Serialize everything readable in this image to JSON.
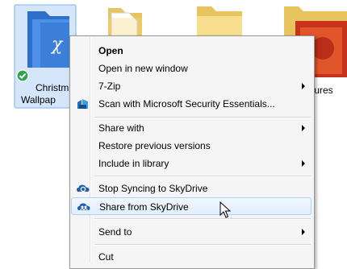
{
  "desktop": {
    "selected_folder_label": "Christmas Wallpapers",
    "selected_folder_label_visible_line1": "Christm",
    "selected_folder_label_visible_line2": "Wallpap",
    "right_edge_label": "tures"
  },
  "context_menu": {
    "items": [
      {
        "label": "Open",
        "bold": true
      },
      {
        "label": "Open in new window"
      },
      {
        "label": "7-Zip",
        "submenu": true
      },
      {
        "label": "Scan with Microsoft Security Essentials...",
        "icon": "security-essentials-icon"
      },
      {
        "label": "Share with",
        "submenu": true
      },
      {
        "label": "Restore previous versions"
      },
      {
        "label": "Include in library",
        "submenu": true
      },
      {
        "label": "Stop Syncing to SkyDrive",
        "icon": "skydrive-sync-icon"
      },
      {
        "label": "Share from SkyDrive",
        "icon": "skydrive-share-icon",
        "highlighted": true
      },
      {
        "label": "Send to",
        "submenu": true
      },
      {
        "label": "Cut"
      }
    ]
  },
  "colors": {
    "selection": "#d5e6fb",
    "selection_border": "#7fb0ea",
    "menu_bg": "#f5f5f5",
    "highlight_border": "#aecff7",
    "folder_yellow": "#f3d67a",
    "folder_blue": "#3b7fd9"
  }
}
